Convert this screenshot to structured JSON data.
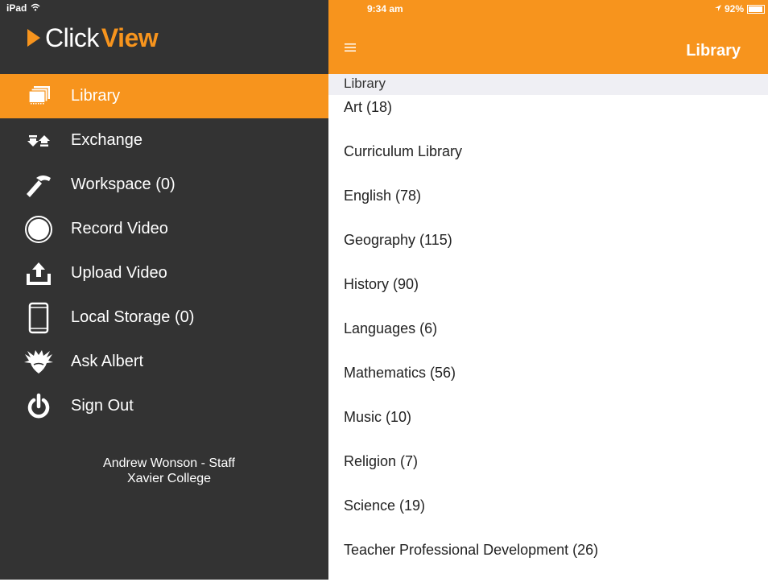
{
  "statusbar": {
    "device": "iPad",
    "time": "9:34 am",
    "battery": "92%",
    "battery_level": 0.92
  },
  "sidebar": {
    "logo_click": "Click",
    "logo_view": "View",
    "items": [
      {
        "label": "Library",
        "icon": "library-icon",
        "active": true
      },
      {
        "label": "Exchange",
        "icon": "exchange-icon",
        "active": false
      },
      {
        "label": "Workspace (0)",
        "icon": "hammer-icon",
        "active": false
      },
      {
        "label": "Record Video",
        "icon": "record-icon",
        "active": false
      },
      {
        "label": "Upload Video",
        "icon": "upload-icon",
        "active": false
      },
      {
        "label": "Local Storage (0)",
        "icon": "device-icon",
        "active": false
      },
      {
        "label": "Ask Albert",
        "icon": "albert-icon",
        "active": false
      },
      {
        "label": "Sign Out",
        "icon": "power-icon",
        "active": false
      }
    ],
    "user_name": "Andrew Wonson - Staff",
    "school": "Xavier College"
  },
  "main": {
    "title": "Library",
    "section_header": "Library",
    "items": [
      "Art (18)",
      "Curriculum Library",
      "English (78)",
      "Geography (115)",
      "History (90)",
      "Languages (6)",
      "Mathematics (56)",
      "Music (10)",
      "Religion (7)",
      "Science (19)",
      "Teacher Professional Development (26)"
    ]
  },
  "colors": {
    "accent": "#f7941d",
    "sidebar_bg": "#333333",
    "section_bg": "#efeff4"
  }
}
